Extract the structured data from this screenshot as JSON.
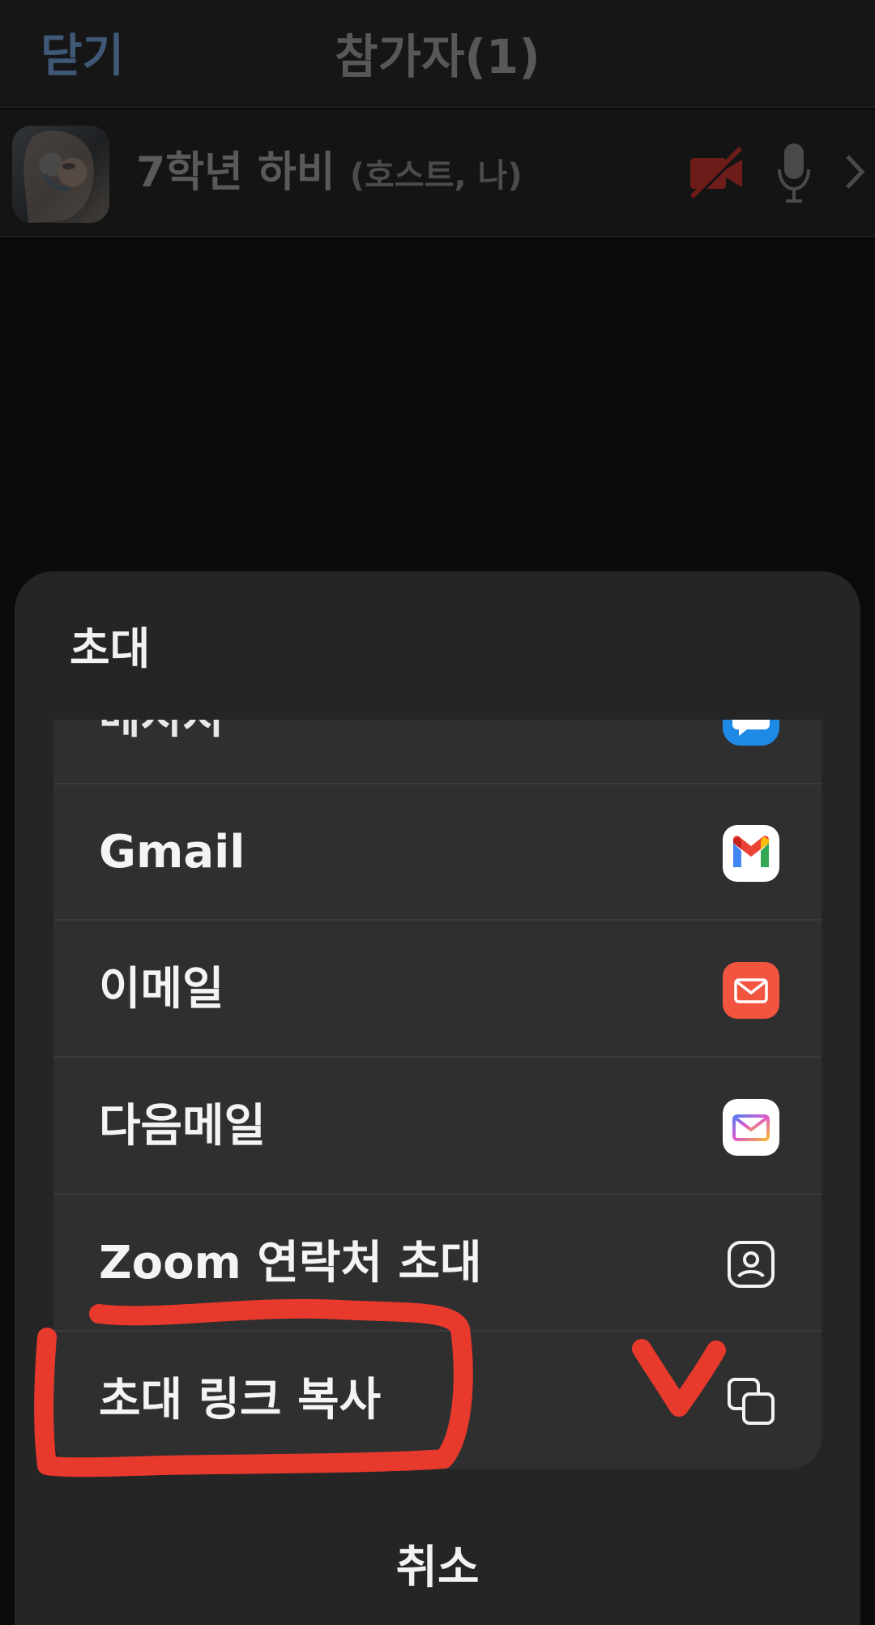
{
  "header": {
    "close_label": "닫기",
    "title": "참가자(1)"
  },
  "participant": {
    "name": "7학년 하비",
    "role": "(호스트, 나)",
    "camera_state": "off",
    "mic_state": "muted"
  },
  "invite_sheet": {
    "title": "초대",
    "partial_item_label": "메시지",
    "items": [
      {
        "label": "Gmail",
        "icon": "gmail-icon"
      },
      {
        "label": "이메일",
        "icon": "email-icon"
      },
      {
        "label": "다음메일",
        "icon": "daum-mail-icon"
      },
      {
        "label": "Zoom 연락처 초대",
        "icon": "contact-icon"
      },
      {
        "label": "초대 링크 복사",
        "icon": "copy-icon"
      }
    ],
    "cancel_label": "취소"
  },
  "colors": {
    "background": "#0b0b0b",
    "sheet": "#252525",
    "list_card": "#2f2f2f",
    "annotation_red": "#e8392d",
    "close_blue": "#3f5878"
  }
}
